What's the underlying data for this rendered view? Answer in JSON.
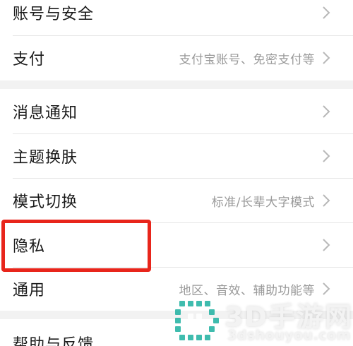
{
  "settings": {
    "account_security": {
      "label": "账号与安全"
    },
    "payment": {
      "label": "支付",
      "value": "支付宝账号、免密支付等"
    },
    "notifications": {
      "label": "消息通知"
    },
    "theme": {
      "label": "主题换肤"
    },
    "mode_switch": {
      "label": "模式切换",
      "value": "标准/长辈大字模式"
    },
    "privacy": {
      "label": "隐私"
    },
    "general": {
      "label": "通用",
      "value": "地区、音效、辅助功能等"
    },
    "help": {
      "label": "帮助与反馈"
    }
  },
  "highlight": {
    "color": "#e8251b"
  },
  "watermark": {
    "title": "3D手游网",
    "url": "3dshouyou.com"
  }
}
